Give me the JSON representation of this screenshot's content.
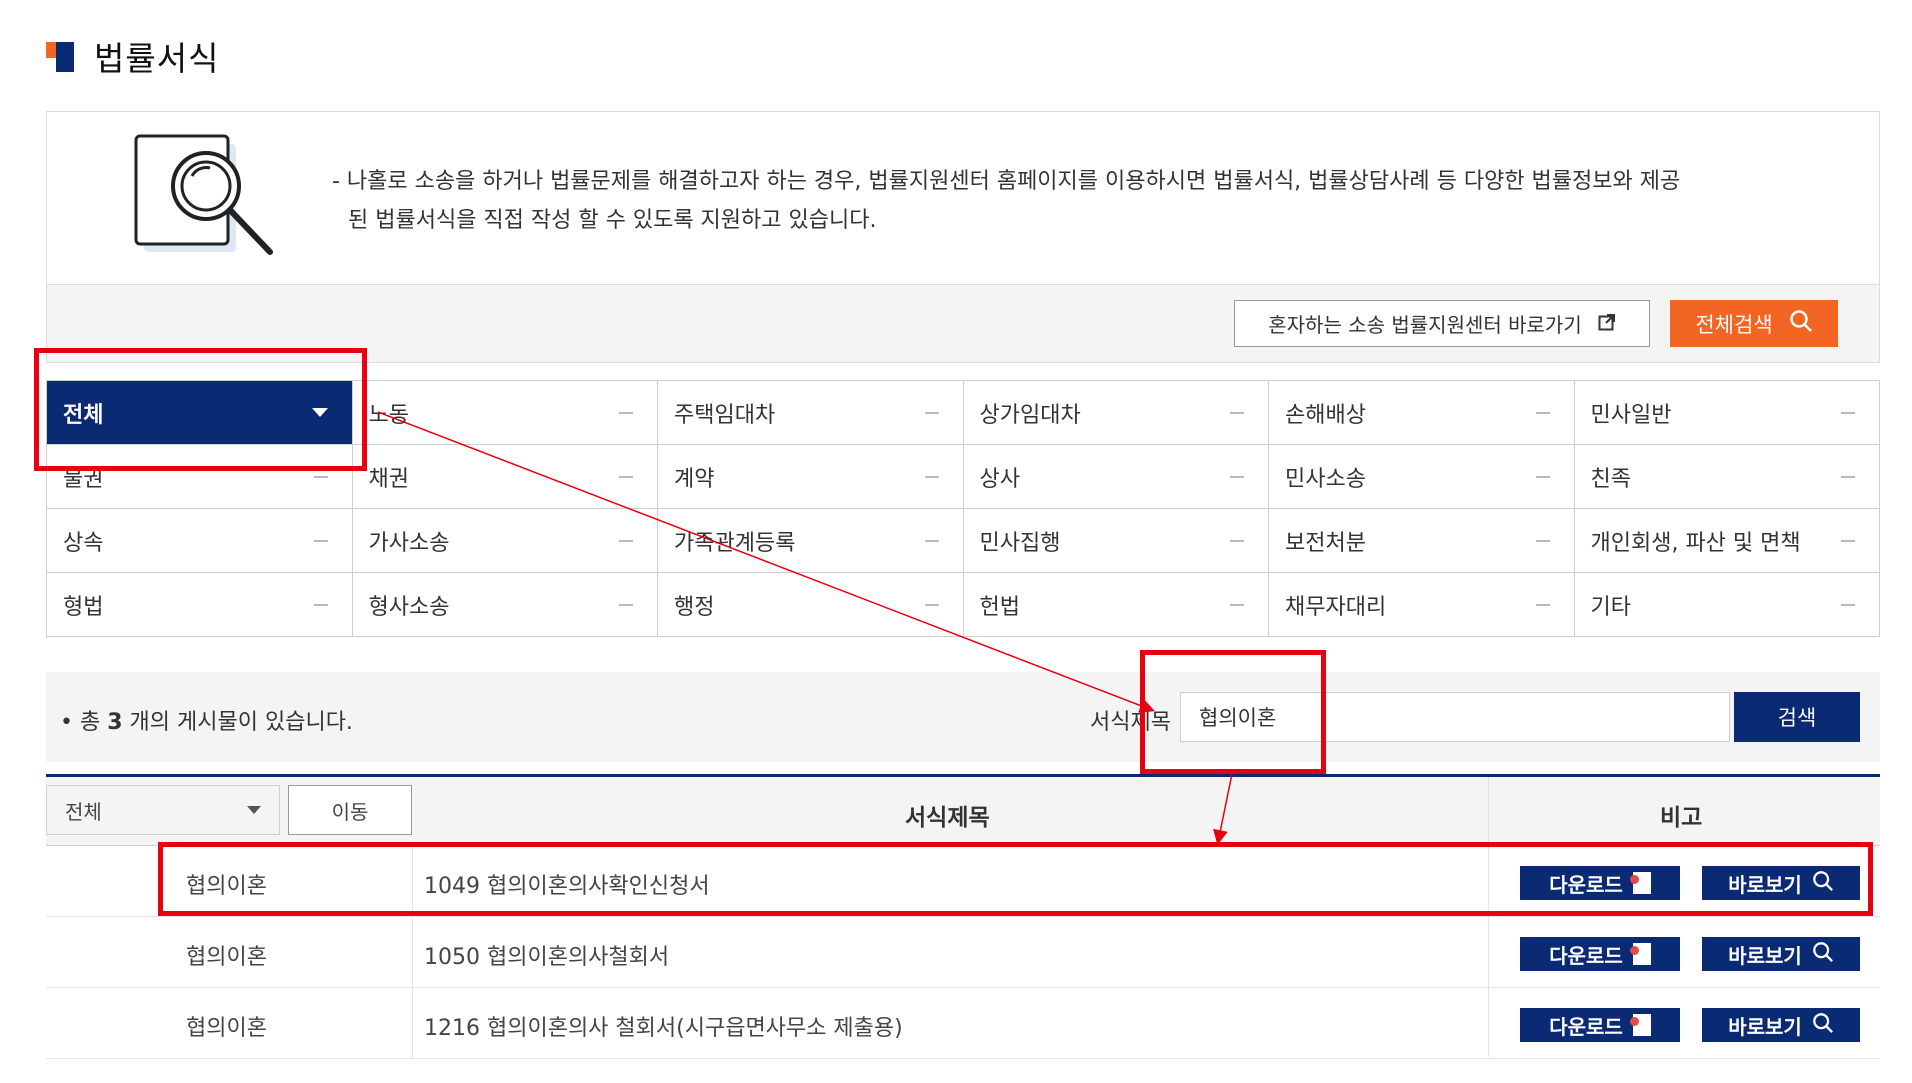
{
  "page": {
    "title": "법률서식"
  },
  "intro": {
    "line1": "- 나홀로 소송을 하거나 법률문제를 해결하고자 하는 경우, 법률지원센터 홈페이지를 이용하시면 법률서식, 법률상담사례 등 다양한 법률정보와 제공",
    "line2": "된 법률서식을 직접 작성 할 수 있도록 지원하고 있습니다."
  },
  "actions": {
    "link_label": "혼자하는 소송 법률지원센터 바로가기",
    "search_all_label": "전체검색"
  },
  "categories": [
    [
      "전체",
      "노동",
      "주택임대차",
      "상가임대차",
      "손해배상",
      "민사일반"
    ],
    [
      "물권",
      "채권",
      "계약",
      "상사",
      "민사소송",
      "친족"
    ],
    [
      "상속",
      "가사소송",
      "가족관계등록",
      "민사집행",
      "보전처분",
      "개인회생, 파산 및 면책"
    ],
    [
      "형법",
      "형사소송",
      "행정",
      "헌법",
      "채무자대리",
      "기타"
    ]
  ],
  "search": {
    "total_prefix": "총",
    "total_count": "3",
    "total_suffix": "개의 게시물이 있습니다.",
    "field_label": "서식제목",
    "query": "협의이혼",
    "button": "검색"
  },
  "table": {
    "filter_value": "전체",
    "move_button": "이동",
    "col_title": "서식제목",
    "col_note": "비고",
    "download_label": "다운로드",
    "view_label": "바로보기",
    "rows": [
      {
        "category": "협의이혼",
        "title": "1049 협의이혼의사확인신청서"
      },
      {
        "category": "협의이혼",
        "title": "1050 협의이혼의사철회서"
      },
      {
        "category": "협의이혼",
        "title": "1216 협의이혼의사 철회서(시구읍면사무소 제출용)"
      }
    ]
  },
  "colors": {
    "navy": "#0a2a73",
    "orange": "#f26522",
    "annotation_red": "#e60012"
  }
}
